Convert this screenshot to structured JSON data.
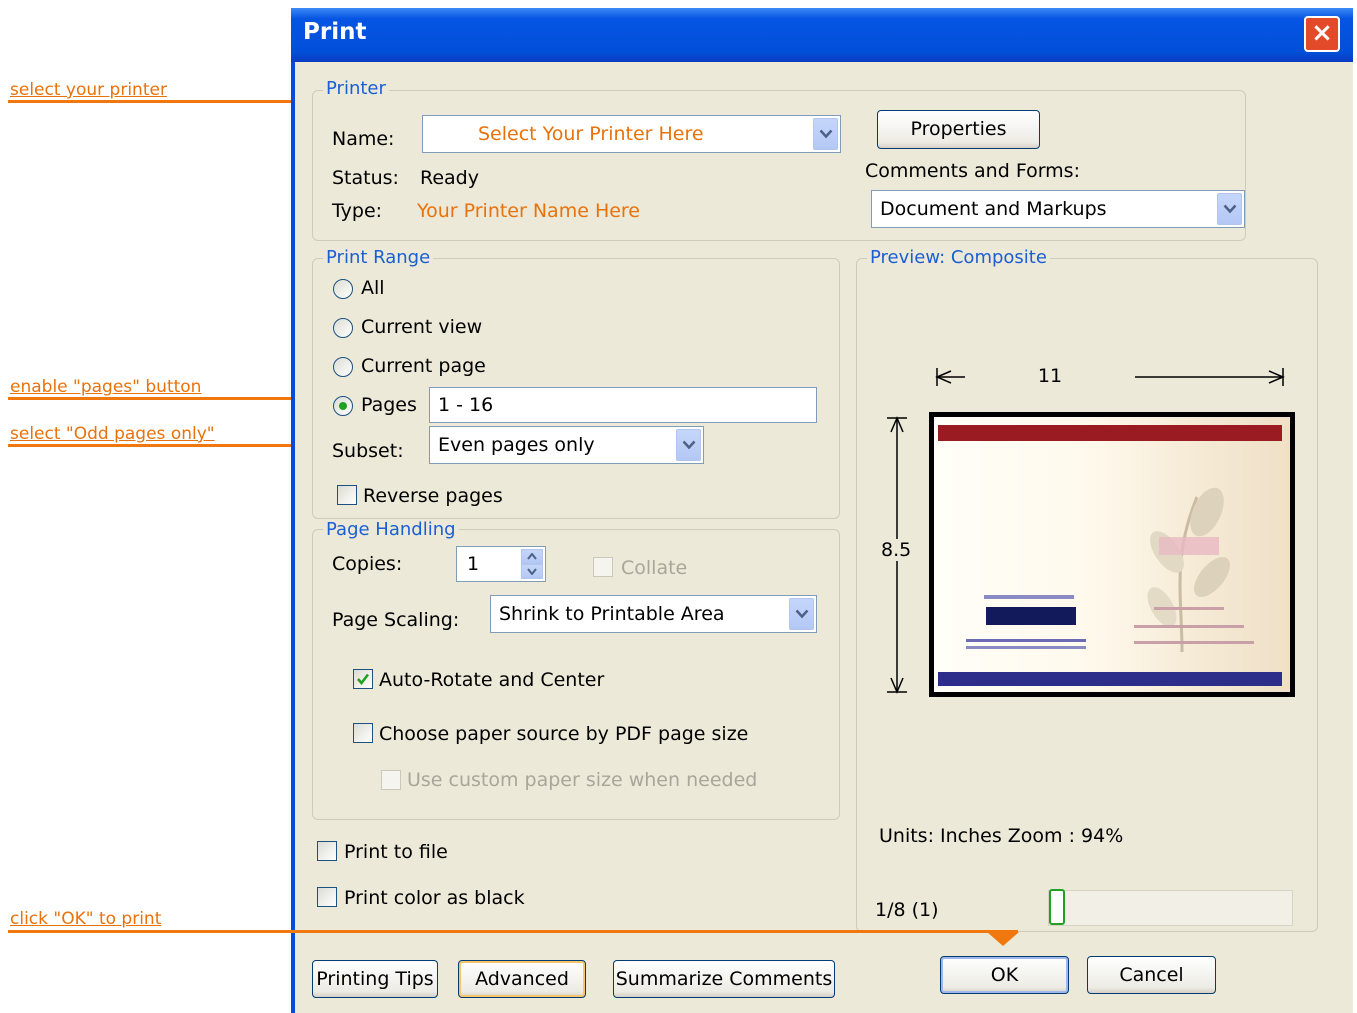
{
  "annotations": {
    "printer": "select your printer",
    "pages": "enable \"pages\" button",
    "subset": "select \"Odd pages only\"",
    "ok": "click \"OK\" to print"
  },
  "dialog": {
    "title": "Print",
    "close_label": "×"
  },
  "printer": {
    "legend": "Printer",
    "name_label": "Name:",
    "name_value": "Select Your Printer Here",
    "status_label": "Status:",
    "status_value": "Ready",
    "type_label": "Type:",
    "type_value": "Your Printer Name Here",
    "properties_button": "Properties",
    "comments_label": "Comments and Forms:",
    "comments_value": "Document and Markups"
  },
  "print_range": {
    "legend": "Print Range",
    "all": "All",
    "current_view": "Current view",
    "current_page": "Current page",
    "pages": "Pages",
    "pages_value": "1 - 16",
    "subset_label": "Subset:",
    "subset_value": "Even pages only",
    "reverse": "Reverse pages",
    "selected": "pages"
  },
  "page_handling": {
    "legend": "Page Handling",
    "copies_label": "Copies:",
    "copies_value": "1",
    "collate": "Collate",
    "scaling_label": "Page Scaling:",
    "scaling_value": "Shrink to Printable Area",
    "auto_rotate": "Auto-Rotate and Center",
    "auto_rotate_checked": true,
    "paper_source": "Choose paper source by PDF page size",
    "custom_paper": "Use custom paper size when needed"
  },
  "options": {
    "print_to_file": "Print to file",
    "color_as_black": "Print color as black"
  },
  "preview": {
    "legend": "Preview: Composite",
    "width_label": "11",
    "height_label": "8.5",
    "units_zoom": "Units: Inches Zoom :  94%",
    "page_indicator": "1/8 (1)"
  },
  "buttons": {
    "printing_tips": "Printing Tips",
    "advanced": "Advanced",
    "summarize": "Summarize Comments",
    "ok": "OK",
    "cancel": "Cancel"
  },
  "colors": {
    "accent_orange": "#e8720c",
    "title_blue": "#0250da",
    "dialog_bg": "#ece9d8",
    "legend_blue": "#1a5fd4"
  }
}
